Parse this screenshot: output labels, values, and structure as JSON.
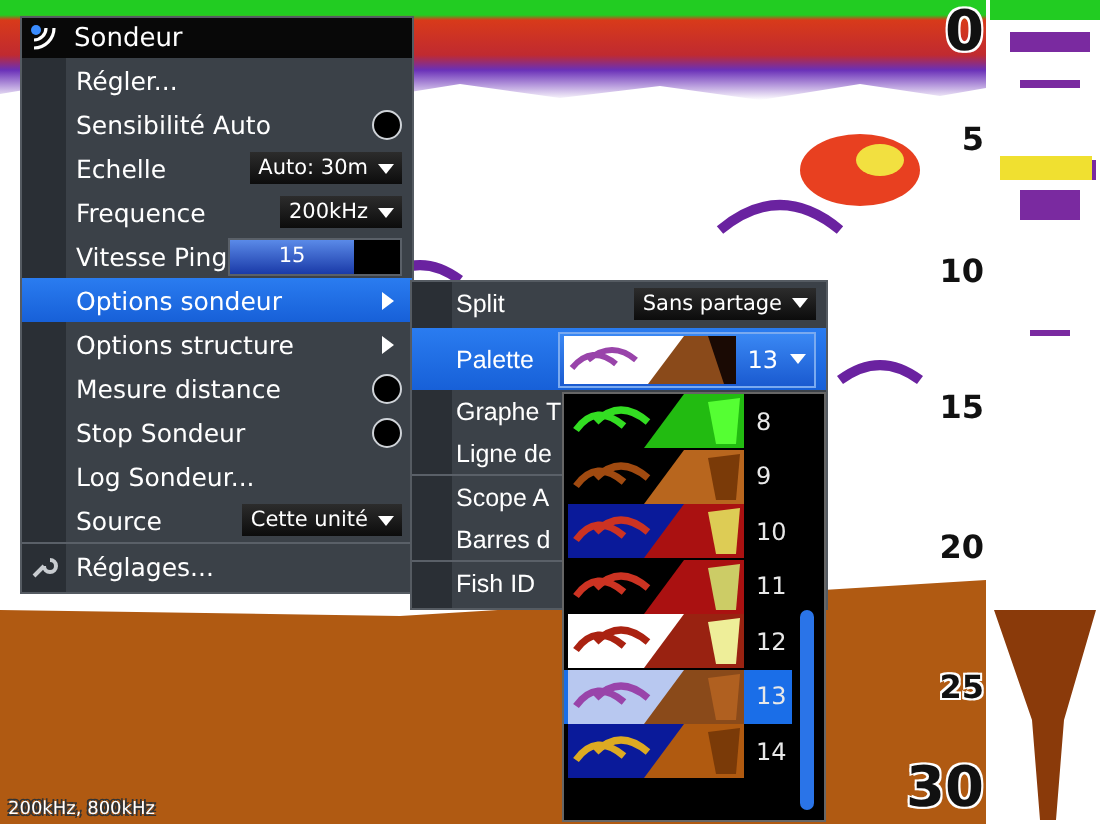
{
  "depth_scale": [
    "0",
    "5",
    "10",
    "15",
    "20",
    "25",
    "30"
  ],
  "frequency_label": "200kHz, 800kHz",
  "menu": {
    "title": "Sondeur",
    "items": [
      {
        "kind": "action",
        "label": "Régler...",
        "selected": false
      },
      {
        "kind": "toggle",
        "label": "Sensibilité Auto",
        "checked": false,
        "selected": false
      },
      {
        "kind": "dropdown",
        "label": "Echelle",
        "value": "Auto: 30m",
        "selected": false
      },
      {
        "kind": "dropdown",
        "label": "Frequence",
        "value": "200kHz",
        "selected": false
      },
      {
        "kind": "slider",
        "label": "Vitesse Ping",
        "value": "15",
        "level": 0.73,
        "selected": false
      },
      {
        "kind": "submenu",
        "label": "Options sondeur",
        "selected": true
      },
      {
        "kind": "submenu",
        "label": "Options structure",
        "selected": false
      },
      {
        "kind": "toggle",
        "label": "Mesure distance",
        "checked": false,
        "selected": false
      },
      {
        "kind": "toggle",
        "label": "Stop Sondeur",
        "checked": false,
        "selected": false
      },
      {
        "kind": "action",
        "label": "Log Sondeur...",
        "selected": false
      },
      {
        "kind": "dropdown",
        "label": "Source",
        "value": "Cette unité",
        "selected": false
      },
      {
        "kind": "settings",
        "label": "Réglages...",
        "selected": false
      }
    ]
  },
  "submenu": {
    "items": [
      {
        "kind": "dropdown",
        "label": "Split",
        "value": "Sans partage",
        "selected": false
      },
      {
        "kind": "palette",
        "label": "Palette",
        "value": "13",
        "selected": true
      },
      {
        "kind": "action",
        "label": "Graphe T",
        "selected": false
      },
      {
        "kind": "action",
        "label": "Ligne de",
        "selected": false
      },
      {
        "kind": "action",
        "label": "Scope A",
        "divider_before": true,
        "selected": false
      },
      {
        "kind": "action",
        "label": "Barres d",
        "selected": false
      },
      {
        "kind": "action",
        "label": "Fish ID",
        "divider_before": true,
        "selected": false
      }
    ]
  },
  "palette_list": {
    "items": [
      {
        "label": "8",
        "selected": false
      },
      {
        "label": "9",
        "selected": false
      },
      {
        "label": "10",
        "selected": false
      },
      {
        "label": "11",
        "selected": false
      },
      {
        "label": "12",
        "selected": false
      },
      {
        "label": "13",
        "selected": true
      },
      {
        "label": "14",
        "selected": false
      }
    ]
  }
}
